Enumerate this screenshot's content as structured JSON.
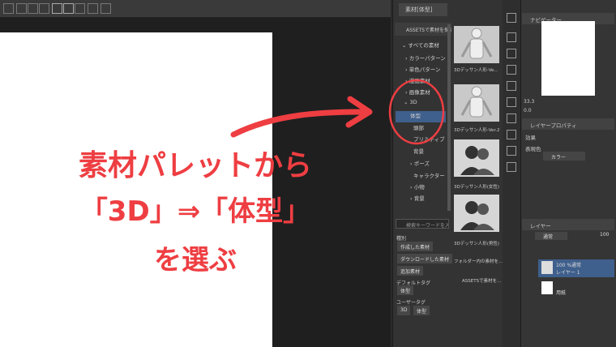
{
  "caption": {
    "line1": "素材パレットから",
    "line2": "「3D」⇒「体型」",
    "line3": "を選ぶ"
  },
  "material_panel": {
    "tab_label": "素材[体型]",
    "assets_label": "ASSETSで素材を探す",
    "tree": [
      {
        "label": "すべての素材",
        "prefix": "⌄"
      },
      {
        "label": "カラーパターン",
        "prefix": "›"
      },
      {
        "label": "単色パターン",
        "prefix": "›"
      },
      {
        "label": "漫画素材",
        "prefix": "›"
      },
      {
        "label": "画像素材",
        "prefix": "›"
      },
      {
        "label": "3D",
        "prefix": "⌄"
      },
      {
        "label": "体型",
        "prefix": ""
      },
      {
        "label": "頭部",
        "prefix": ""
      },
      {
        "label": "プリミティブ",
        "prefix": ""
      },
      {
        "label": "背景",
        "prefix": ""
      },
      {
        "label": "ポーズ",
        "prefix": "›"
      },
      {
        "label": "キャラクター",
        "prefix": ""
      },
      {
        "label": "小物",
        "prefix": "›"
      },
      {
        "label": "背景",
        "prefix": "›"
      }
    ],
    "search_placeholder": "検索キーワードを入",
    "type_label": "種別",
    "type_tags": [
      "作成した素材",
      "ダウンロードした素材",
      "追加素材"
    ],
    "default_tag_label": "デフォルトタグ",
    "default_tags": [
      "体型"
    ],
    "user_tag_label": "ユーザータグ",
    "user_tags": [
      "3D",
      "体型"
    ],
    "thumbnails": [
      {
        "label": "3Dデッサン人形-Ve...",
        "kind": "mannequin"
      },
      {
        "label": "3Dデッサン人形-Ver.2",
        "kind": "mannequin"
      },
      {
        "label": "3Dデッサン人形(女性)",
        "kind": "silhouette"
      },
      {
        "label": "3Dデッサン人形(男性)",
        "kind": "silhouette"
      },
      {
        "label": "フォルダー内の素材を..."
      },
      {
        "label": "ASSETSで素材を..."
      }
    ]
  },
  "right_panel": {
    "navigator_label": "ナビゲーター",
    "zoom_value": "33.3",
    "angle_value": "0.0",
    "layer_prop_label": "レイヤープロパティ",
    "effect_label": "効果",
    "expression_color_label": "表現色",
    "color_mode_value": "カラー",
    "layer_panel_label": "レイヤー",
    "blend_mode_value": "通常",
    "opacity_value": "100",
    "layers": [
      {
        "line1": "100 %通常",
        "line2": "レイヤー 1",
        "selected": true
      },
      {
        "line1": "",
        "line2": "用紙",
        "selected": false
      }
    ]
  },
  "colors": {
    "caption_red": "#ee3e42",
    "selection_blue": "#3f5f8c",
    "panel_bg": "#333333"
  }
}
